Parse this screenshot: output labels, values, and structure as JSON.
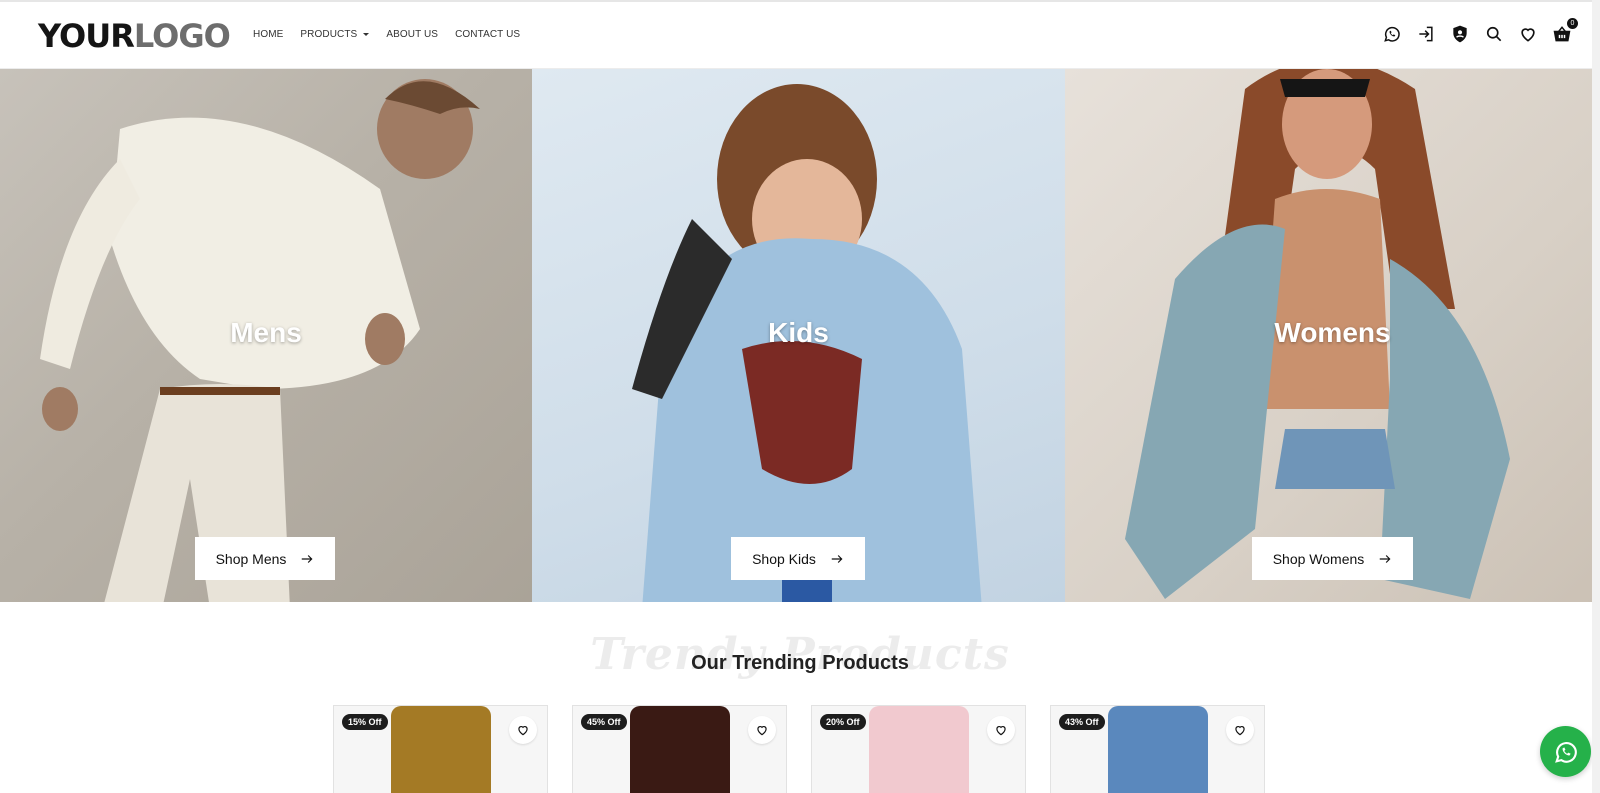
{
  "header": {
    "logo_dark": "YOUR",
    "logo_grey": "LOGO",
    "nav": [
      {
        "label": "HOME"
      },
      {
        "label": "PRODUCTS"
      },
      {
        "label": "ABOUT US"
      },
      {
        "label": "CONTACT US"
      }
    ],
    "icons": [
      "whatsapp-icon",
      "login-icon",
      "shield-user-icon",
      "search-icon",
      "heart-icon",
      "basket-icon"
    ],
    "cart_count": "0"
  },
  "hero": [
    {
      "title": "Mens",
      "button": "Shop Mens"
    },
    {
      "title": "Kids",
      "button": "Shop Kids"
    },
    {
      "title": "Womens",
      "button": "Shop Womens"
    }
  ],
  "trending": {
    "watermark": "Trendy Products",
    "title": "Our Trending Products"
  },
  "products": [
    {
      "badge": "15% Off",
      "color": "#a47a25"
    },
    {
      "badge": "45% Off",
      "color": "#3a1a14"
    },
    {
      "badge": "20% Off",
      "color": "#f1c9cf"
    },
    {
      "badge": "43% Off",
      "color": "#5a88bd"
    }
  ],
  "colors": {
    "accent_whatsapp": "#25b14a",
    "logo_red": "#e01b24"
  }
}
